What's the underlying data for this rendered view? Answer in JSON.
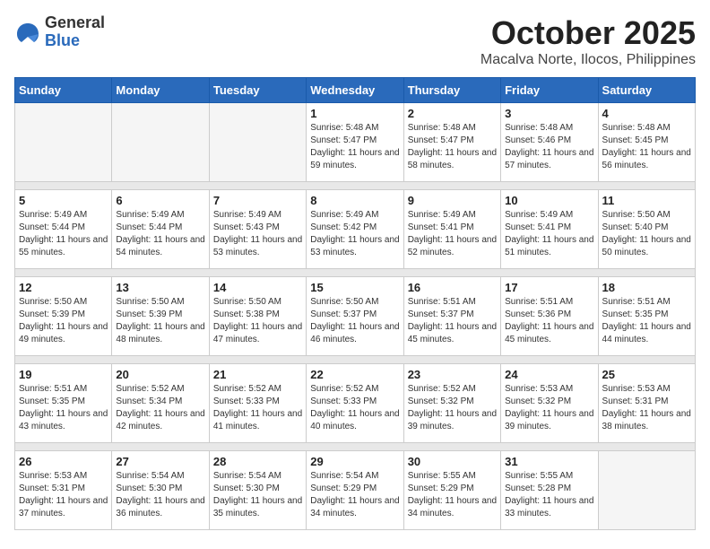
{
  "logo": {
    "general": "General",
    "blue": "Blue"
  },
  "title": {
    "month": "October 2025",
    "location": "Macalva Norte, Ilocos, Philippines"
  },
  "weekdays": [
    "Sunday",
    "Monday",
    "Tuesday",
    "Wednesday",
    "Thursday",
    "Friday",
    "Saturday"
  ],
  "weeks": [
    [
      {
        "day": "",
        "sunrise": "",
        "sunset": "",
        "daylight": ""
      },
      {
        "day": "",
        "sunrise": "",
        "sunset": "",
        "daylight": ""
      },
      {
        "day": "",
        "sunrise": "",
        "sunset": "",
        "daylight": ""
      },
      {
        "day": "1",
        "sunrise": "Sunrise: 5:48 AM",
        "sunset": "Sunset: 5:47 PM",
        "daylight": "Daylight: 11 hours and 59 minutes."
      },
      {
        "day": "2",
        "sunrise": "Sunrise: 5:48 AM",
        "sunset": "Sunset: 5:47 PM",
        "daylight": "Daylight: 11 hours and 58 minutes."
      },
      {
        "day": "3",
        "sunrise": "Sunrise: 5:48 AM",
        "sunset": "Sunset: 5:46 PM",
        "daylight": "Daylight: 11 hours and 57 minutes."
      },
      {
        "day": "4",
        "sunrise": "Sunrise: 5:48 AM",
        "sunset": "Sunset: 5:45 PM",
        "daylight": "Daylight: 11 hours and 56 minutes."
      }
    ],
    [
      {
        "day": "5",
        "sunrise": "Sunrise: 5:49 AM",
        "sunset": "Sunset: 5:44 PM",
        "daylight": "Daylight: 11 hours and 55 minutes."
      },
      {
        "day": "6",
        "sunrise": "Sunrise: 5:49 AM",
        "sunset": "Sunset: 5:44 PM",
        "daylight": "Daylight: 11 hours and 54 minutes."
      },
      {
        "day": "7",
        "sunrise": "Sunrise: 5:49 AM",
        "sunset": "Sunset: 5:43 PM",
        "daylight": "Daylight: 11 hours and 53 minutes."
      },
      {
        "day": "8",
        "sunrise": "Sunrise: 5:49 AM",
        "sunset": "Sunset: 5:42 PM",
        "daylight": "Daylight: 11 hours and 53 minutes."
      },
      {
        "day": "9",
        "sunrise": "Sunrise: 5:49 AM",
        "sunset": "Sunset: 5:41 PM",
        "daylight": "Daylight: 11 hours and 52 minutes."
      },
      {
        "day": "10",
        "sunrise": "Sunrise: 5:49 AM",
        "sunset": "Sunset: 5:41 PM",
        "daylight": "Daylight: 11 hours and 51 minutes."
      },
      {
        "day": "11",
        "sunrise": "Sunrise: 5:50 AM",
        "sunset": "Sunset: 5:40 PM",
        "daylight": "Daylight: 11 hours and 50 minutes."
      }
    ],
    [
      {
        "day": "12",
        "sunrise": "Sunrise: 5:50 AM",
        "sunset": "Sunset: 5:39 PM",
        "daylight": "Daylight: 11 hours and 49 minutes."
      },
      {
        "day": "13",
        "sunrise": "Sunrise: 5:50 AM",
        "sunset": "Sunset: 5:39 PM",
        "daylight": "Daylight: 11 hours and 48 minutes."
      },
      {
        "day": "14",
        "sunrise": "Sunrise: 5:50 AM",
        "sunset": "Sunset: 5:38 PM",
        "daylight": "Daylight: 11 hours and 47 minutes."
      },
      {
        "day": "15",
        "sunrise": "Sunrise: 5:50 AM",
        "sunset": "Sunset: 5:37 PM",
        "daylight": "Daylight: 11 hours and 46 minutes."
      },
      {
        "day": "16",
        "sunrise": "Sunrise: 5:51 AM",
        "sunset": "Sunset: 5:37 PM",
        "daylight": "Daylight: 11 hours and 45 minutes."
      },
      {
        "day": "17",
        "sunrise": "Sunrise: 5:51 AM",
        "sunset": "Sunset: 5:36 PM",
        "daylight": "Daylight: 11 hours and 45 minutes."
      },
      {
        "day": "18",
        "sunrise": "Sunrise: 5:51 AM",
        "sunset": "Sunset: 5:35 PM",
        "daylight": "Daylight: 11 hours and 44 minutes."
      }
    ],
    [
      {
        "day": "19",
        "sunrise": "Sunrise: 5:51 AM",
        "sunset": "Sunset: 5:35 PM",
        "daylight": "Daylight: 11 hours and 43 minutes."
      },
      {
        "day": "20",
        "sunrise": "Sunrise: 5:52 AM",
        "sunset": "Sunset: 5:34 PM",
        "daylight": "Daylight: 11 hours and 42 minutes."
      },
      {
        "day": "21",
        "sunrise": "Sunrise: 5:52 AM",
        "sunset": "Sunset: 5:33 PM",
        "daylight": "Daylight: 11 hours and 41 minutes."
      },
      {
        "day": "22",
        "sunrise": "Sunrise: 5:52 AM",
        "sunset": "Sunset: 5:33 PM",
        "daylight": "Daylight: 11 hours and 40 minutes."
      },
      {
        "day": "23",
        "sunrise": "Sunrise: 5:52 AM",
        "sunset": "Sunset: 5:32 PM",
        "daylight": "Daylight: 11 hours and 39 minutes."
      },
      {
        "day": "24",
        "sunrise": "Sunrise: 5:53 AM",
        "sunset": "Sunset: 5:32 PM",
        "daylight": "Daylight: 11 hours and 39 minutes."
      },
      {
        "day": "25",
        "sunrise": "Sunrise: 5:53 AM",
        "sunset": "Sunset: 5:31 PM",
        "daylight": "Daylight: 11 hours and 38 minutes."
      }
    ],
    [
      {
        "day": "26",
        "sunrise": "Sunrise: 5:53 AM",
        "sunset": "Sunset: 5:31 PM",
        "daylight": "Daylight: 11 hours and 37 minutes."
      },
      {
        "day": "27",
        "sunrise": "Sunrise: 5:54 AM",
        "sunset": "Sunset: 5:30 PM",
        "daylight": "Daylight: 11 hours and 36 minutes."
      },
      {
        "day": "28",
        "sunrise": "Sunrise: 5:54 AM",
        "sunset": "Sunset: 5:30 PM",
        "daylight": "Daylight: 11 hours and 35 minutes."
      },
      {
        "day": "29",
        "sunrise": "Sunrise: 5:54 AM",
        "sunset": "Sunset: 5:29 PM",
        "daylight": "Daylight: 11 hours and 34 minutes."
      },
      {
        "day": "30",
        "sunrise": "Sunrise: 5:55 AM",
        "sunset": "Sunset: 5:29 PM",
        "daylight": "Daylight: 11 hours and 34 minutes."
      },
      {
        "day": "31",
        "sunrise": "Sunrise: 5:55 AM",
        "sunset": "Sunset: 5:28 PM",
        "daylight": "Daylight: 11 hours and 33 minutes."
      },
      {
        "day": "",
        "sunrise": "",
        "sunset": "",
        "daylight": ""
      }
    ]
  ]
}
